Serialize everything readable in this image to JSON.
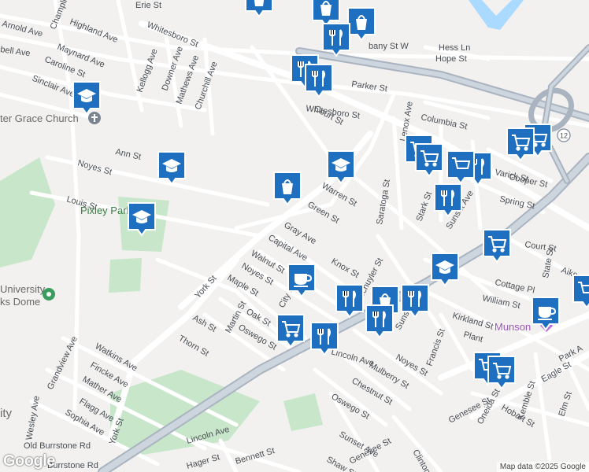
{
  "map": {
    "street_labels": [
      {
        "id": "erie-st",
        "text": "Erie St"
      },
      {
        "id": "champlin-ave",
        "text": "Champlin Ave"
      },
      {
        "id": "highland-ave",
        "text": "Highland Ave"
      },
      {
        "id": "arnold-ave",
        "text": "Arnold Ave"
      },
      {
        "id": "maynard-ave",
        "text": "Maynard Ave"
      },
      {
        "id": "bell-ave",
        "text": "bell Ave"
      },
      {
        "id": "caroline-st",
        "text": "Caroline St"
      },
      {
        "id": "sinclair-ave",
        "text": "Sinclair Ave"
      },
      {
        "id": "kellogg-ave",
        "text": "Kellogg Ave"
      },
      {
        "id": "downer-ave",
        "text": "Downer Ave"
      },
      {
        "id": "mathews-ave",
        "text": "Mathews Ave"
      },
      {
        "id": "churchill-ave",
        "text": "Churchill Ave"
      },
      {
        "id": "whitesboro-st-top",
        "text": "Whitesboro St"
      },
      {
        "id": "whitesboro-st-mid",
        "text": "Whitesboro St"
      },
      {
        "id": "bany-st-w",
        "text": "bany St W"
      },
      {
        "id": "hess-ln",
        "text": "Hess Ln"
      },
      {
        "id": "hope-st",
        "text": "Hope St"
      },
      {
        "id": "parker-st",
        "text": "Parker St"
      },
      {
        "id": "court-st-upper",
        "text": "Court St"
      },
      {
        "id": "court-st-lower",
        "text": "Court St"
      },
      {
        "id": "columbia-st",
        "text": "Columbia St"
      },
      {
        "id": "lenox-ave",
        "text": "Lenox Ave"
      },
      {
        "id": "varick-st",
        "text": "Varick St"
      },
      {
        "id": "cooper-st",
        "text": "Cooper St"
      },
      {
        "id": "spring-st",
        "text": "Spring St"
      },
      {
        "id": "ann-st",
        "text": "Ann St"
      },
      {
        "id": "noyes-st-west",
        "text": "Noyes St"
      },
      {
        "id": "louis-st",
        "text": "Louis St"
      },
      {
        "id": "warren-st",
        "text": "Warren St"
      },
      {
        "id": "green-st",
        "text": "Green St"
      },
      {
        "id": "gray-ave",
        "text": "Gray Ave"
      },
      {
        "id": "capital-ave",
        "text": "Capital Ave"
      },
      {
        "id": "walnut-st",
        "text": "Walnut St"
      },
      {
        "id": "noyes-st-mid",
        "text": "Noyes St"
      },
      {
        "id": "maple-st",
        "text": "Maple St"
      },
      {
        "id": "city-st",
        "text": "City St"
      },
      {
        "id": "york-st-north",
        "text": "York St"
      },
      {
        "id": "york-st-south",
        "text": "York St"
      },
      {
        "id": "saratoga-st",
        "text": "Saratoga St"
      },
      {
        "id": "stark-st",
        "text": "Stark St"
      },
      {
        "id": "sunset-ave-north",
        "text": "Sunset Ave"
      },
      {
        "id": "knox-st",
        "text": "Knox St"
      },
      {
        "id": "schuyler-st",
        "text": "Schuyler St"
      },
      {
        "id": "state-st",
        "text": "State St"
      },
      {
        "id": "aiken",
        "text": "Aike"
      },
      {
        "id": "cottage-pl",
        "text": "Cottage Pl"
      },
      {
        "id": "william-st",
        "text": "William St"
      },
      {
        "id": "kirkland-st",
        "text": "Kirkland St"
      },
      {
        "id": "plant-st",
        "text": "Plant"
      },
      {
        "id": "martin-st",
        "text": "Martin St"
      },
      {
        "id": "oak-st",
        "text": "Oak St"
      },
      {
        "id": "ash-st",
        "text": "Ash St"
      },
      {
        "id": "oswego-st-west",
        "text": "Oswego St"
      },
      {
        "id": "thorn-st",
        "text": "Thorn St"
      },
      {
        "id": "watkins-ave",
        "text": "Watkins Ave"
      },
      {
        "id": "fincke-ave",
        "text": "Fincke Ave"
      },
      {
        "id": "mather-ave",
        "text": "Mather Ave"
      },
      {
        "id": "grandview-ave",
        "text": "Grandview Ave"
      },
      {
        "id": "flagg-ave",
        "text": "Flagg Ave"
      },
      {
        "id": "sophia-ave",
        "text": "Sophia Ave"
      },
      {
        "id": "wesley-ave",
        "text": "Wesley Ave"
      },
      {
        "id": "old-burrstone-rd",
        "text": "Old Burrstone Rd"
      },
      {
        "id": "burrstone-rd",
        "text": "Burrstone Rd"
      },
      {
        "id": "lincoln-ave-south",
        "text": "Lincoln Ave"
      },
      {
        "id": "lincoln-ave-mid",
        "text": "Lincoln Ave"
      },
      {
        "id": "mulberry-st",
        "text": "Mulberry St"
      },
      {
        "id": "noyes-st-east",
        "text": "Noyes St"
      },
      {
        "id": "chestnut-st",
        "text": "Chestnut St"
      },
      {
        "id": "oswego-st-east",
        "text": "Oswego St"
      },
      {
        "id": "francis-st",
        "text": "Francis St"
      },
      {
        "id": "sunset-ave-south-1",
        "text": "Sunset Ave"
      },
      {
        "id": "sunset-ave-south-2",
        "text": "Sunset Ave"
      },
      {
        "id": "genesee-st-east",
        "text": "Genesee St"
      },
      {
        "id": "genesee-st-south",
        "text": "Genesee St"
      },
      {
        "id": "oneida-st",
        "text": "Oneida St"
      },
      {
        "id": "hobart-st",
        "text": "Hobart St"
      },
      {
        "id": "kemble-st",
        "text": "Kemble St"
      },
      {
        "id": "eagle-st",
        "text": "Eagle St"
      },
      {
        "id": "elm-st",
        "text": "Elm St"
      },
      {
        "id": "park-ave",
        "text": "Park A"
      },
      {
        "id": "bennett-st",
        "text": "Bennett St"
      },
      {
        "id": "hager-st",
        "text": "Hager St"
      },
      {
        "id": "shaw-st",
        "text": "Shaw St"
      },
      {
        "id": "clinton",
        "text": "Clinton"
      }
    ],
    "poi_labels": {
      "church": "ter Grace Church",
      "park": "Pixley Park",
      "university_line1": "University",
      "university_line2": "ks Dome",
      "hospital": "Munson",
      "city_partial": "ity"
    },
    "highway_shield": "12",
    "pins": [
      {
        "type": "shopping-bag"
      },
      {
        "type": "shopping-bag"
      },
      {
        "type": "restaurant"
      },
      {
        "type": "restaurant"
      },
      {
        "type": "restaurant"
      },
      {
        "type": "school"
      },
      {
        "type": "school"
      },
      {
        "type": "school"
      },
      {
        "type": "school"
      },
      {
        "type": "shopping-cart"
      },
      {
        "type": "shopping-cart"
      },
      {
        "type": "shopping-cart"
      },
      {
        "type": "shopping-cart"
      },
      {
        "type": "restaurant"
      },
      {
        "type": "restaurant"
      },
      {
        "type": "shopping-bag"
      },
      {
        "type": "school"
      },
      {
        "type": "shopping-cart"
      },
      {
        "type": "cafe"
      },
      {
        "type": "restaurant"
      },
      {
        "type": "shopping-bag"
      },
      {
        "type": "restaurant"
      },
      {
        "type": "restaurant"
      },
      {
        "type": "shopping-cart"
      },
      {
        "type": "restaurant"
      },
      {
        "type": "cafe"
      },
      {
        "type": "shopping-cart"
      },
      {
        "type": "shopping-cart"
      },
      {
        "type": "cafe"
      },
      {
        "type": "shopping-cart"
      }
    ],
    "colors": {
      "background": "#f2f1ef",
      "road": "#ffffff",
      "highway": "#aab4c0",
      "park": "#c8e6c9",
      "water": "#aadaff",
      "pin": "#1e6fbf",
      "pin_border": "#ffffff"
    }
  },
  "footer": {
    "logo": "Google",
    "attribution": "Map data ©2025 Google"
  }
}
